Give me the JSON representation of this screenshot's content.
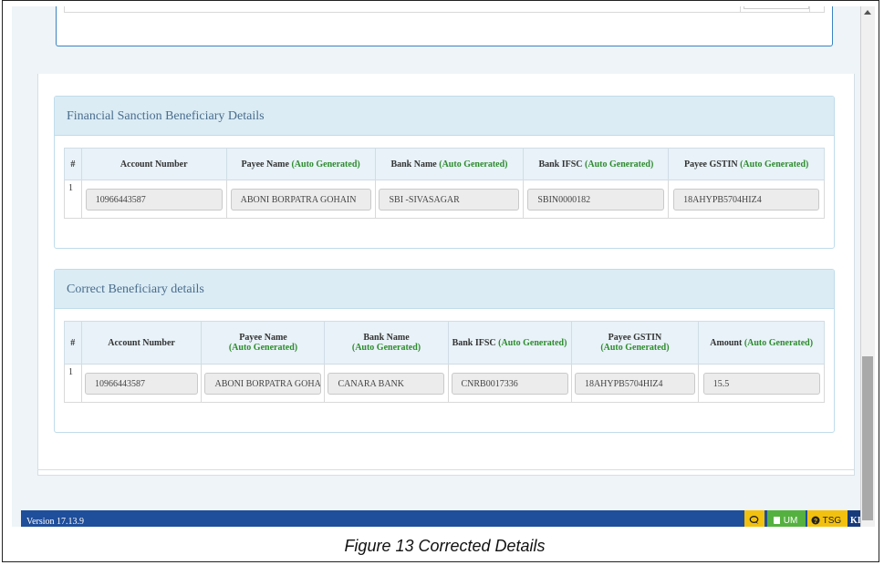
{
  "panel1": {
    "title": "Financial Sanction Beneficiary Details",
    "columns": [
      {
        "label": "#",
        "suffix": ""
      },
      {
        "label": "Account Number",
        "suffix": ""
      },
      {
        "label": "Payee Name ",
        "suffix": "(Auto Generated)"
      },
      {
        "label": "Bank Name ",
        "suffix": "(Auto Generated)"
      },
      {
        "label": "Bank IFSC ",
        "suffix": "(Auto Generated)"
      },
      {
        "label": "Payee GSTIN ",
        "suffix": "(Auto Generated)"
      }
    ],
    "row": {
      "index": "1",
      "account_number": "10966443587",
      "payee_name": "ABONI BORPATRA GOHAIN",
      "bank_name": "SBI -SIVASAGAR",
      "bank_ifsc": "SBIN0000182",
      "payee_gstin": "18AHYPB5704HIZ4"
    }
  },
  "panel2": {
    "title": "Correct Beneficiary details",
    "columns": [
      {
        "label": "#",
        "suffix": ""
      },
      {
        "label": "Account Number",
        "suffix": ""
      },
      {
        "label": "Payee Name",
        "suffix": "(Auto Generated)"
      },
      {
        "label": "Bank Name",
        "suffix": "(Auto Generated)"
      },
      {
        "label": "Bank IFSC ",
        "suffix": "(Auto Generated)"
      },
      {
        "label": "Payee GSTIN",
        "suffix": "(Auto Generated)"
      },
      {
        "label": "Amount ",
        "suffix": "(Auto Generated)"
      }
    ],
    "row": {
      "index": "1",
      "account_number": "10966443587",
      "payee_name": "ABONI BORPATRA GOHAIN",
      "bank_name": "CANARA BANK",
      "bank_ifsc": "CNRB0017336",
      "payee_gstin": "18AHYPB5704HIZ4",
      "amount": "15.5"
    }
  },
  "footer": {
    "version": "Version 17.13.9",
    "chat_icon": "chat-icon",
    "um_label": "UM",
    "um_icon": "book-icon",
    "tsg_label": "TSG",
    "tsg_icon": "question-circle-icon",
    "logo_text": "KII■N"
  },
  "caption": "Figure 13 Corrected Details",
  "colors": {
    "accent_green": "#2e8b2e",
    "header_blue": "#1f4e9a",
    "panel_heading_bg": "#dbecf5"
  }
}
